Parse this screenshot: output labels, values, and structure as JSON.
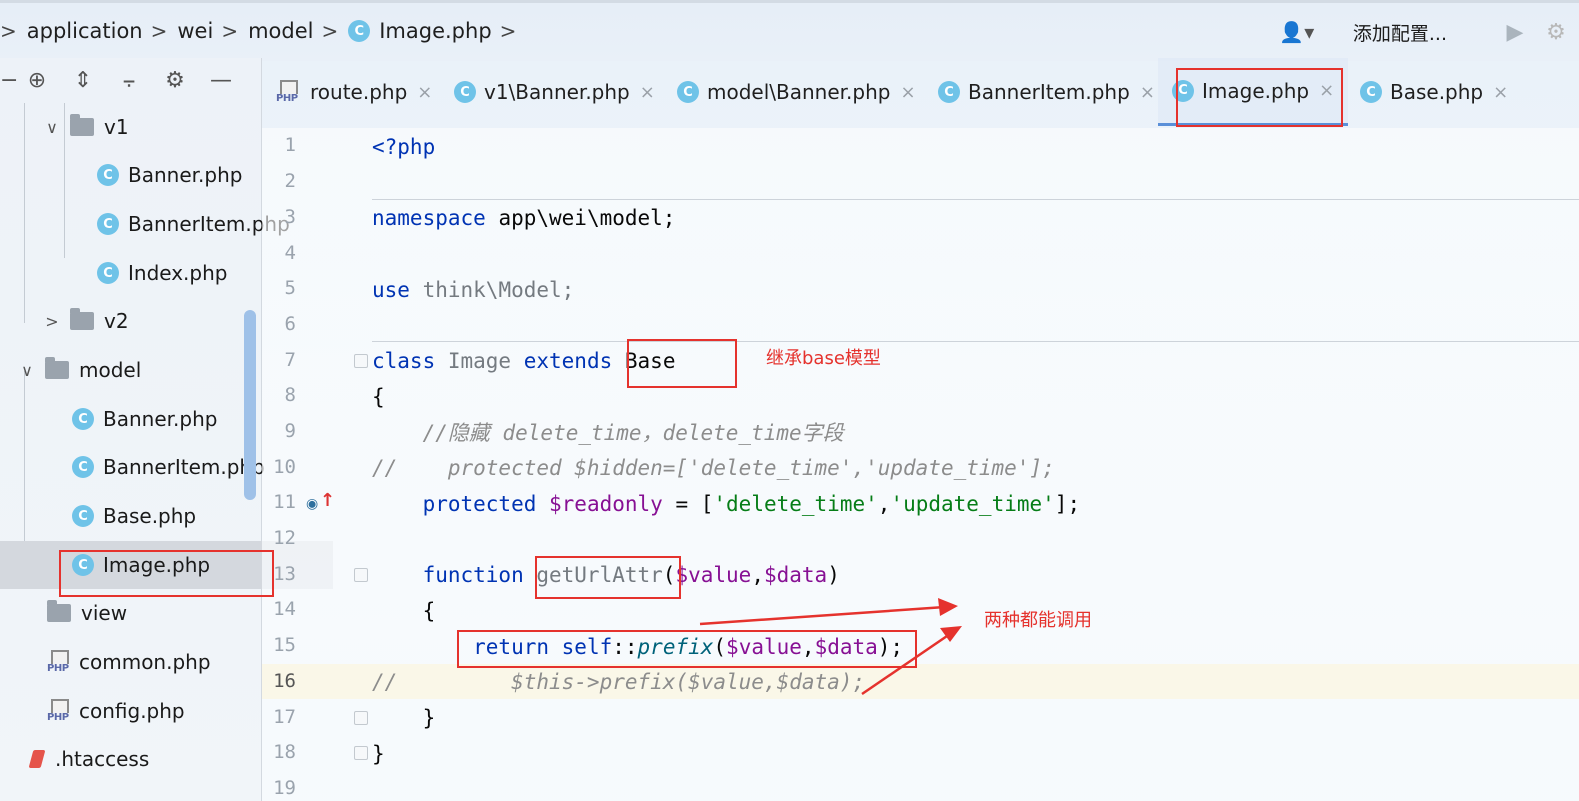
{
  "breadcrumbs": [
    {
      "label": "application"
    },
    {
      "label": "wei"
    },
    {
      "label": "model"
    },
    {
      "label": "Image.php",
      "icon": "class-icon"
    }
  ],
  "toolbar": {
    "config_label": "添加配置...",
    "icons": [
      "user-icon",
      "run-icon",
      "debug-icon"
    ]
  },
  "sidebar": {
    "toolbar_icons": [
      "locate-icon",
      "expand-all-icon",
      "collapse-all-icon",
      "gear-icon",
      "minimize-icon"
    ],
    "tree": [
      {
        "label": "v1",
        "type": "folder",
        "expanded": true
      },
      {
        "label": "Banner.php",
        "type": "class"
      },
      {
        "label": "BannerItem.php",
        "type": "class"
      },
      {
        "label": "Index.php",
        "type": "class"
      },
      {
        "label": "v2",
        "type": "folder",
        "expanded": false
      },
      {
        "label": "model",
        "type": "folder",
        "expanded": true
      },
      {
        "label": "Banner.php",
        "type": "class"
      },
      {
        "label": "BannerItem.php",
        "type": "class"
      },
      {
        "label": "Base.php",
        "type": "class"
      },
      {
        "label": "Image.php",
        "type": "class",
        "selected": true
      },
      {
        "label": "view",
        "type": "folder"
      },
      {
        "label": "common.php",
        "type": "php"
      },
      {
        "label": "config.php",
        "type": "php"
      },
      {
        "label": ".htaccess",
        "type": "htaccess"
      }
    ]
  },
  "tabs": [
    {
      "label": "route.php",
      "type": "php"
    },
    {
      "label": "v1\\Banner.php",
      "type": "class"
    },
    {
      "label": "model\\Banner.php",
      "type": "class"
    },
    {
      "label": "BannerItem.php",
      "type": "class"
    },
    {
      "label": "Image.php",
      "type": "class",
      "active": true
    },
    {
      "label": "Base.php",
      "type": "class"
    }
  ],
  "icon_text": {
    "class": "C",
    "php": "PHP",
    "close": "×"
  },
  "editor": {
    "line_numbers": [
      "1",
      "2",
      "3",
      "4",
      "5",
      "6",
      "7",
      "8",
      "9",
      "10",
      "11",
      "12",
      "13",
      "14",
      "15",
      "16",
      "17",
      "18",
      "19"
    ],
    "current_line": "16",
    "code": {
      "l1": "<?php",
      "l3_kw": "namespace",
      "l3_rest": " app\\wei\\model;",
      "l5_kw": "use",
      "l5_rest": " think\\Model;",
      "l7_kw1": "class",
      "l7_name": " Image ",
      "l7_kw2": "extends",
      "l7_base": " Base",
      "l8": "{",
      "l9": "    //隐藏 delete_time，delete_time字段",
      "l10": "//    protected $hidden=['delete_time','update_time'];",
      "l11_kw": "    protected",
      "l11_var": " $readonly",
      "l11_mid": " = [",
      "l11_s1": "'delete_time'",
      "l11_comma": ",",
      "l11_s2": "'update_time'",
      "l11_end": "];",
      "l13_kw": "    function",
      "l13_name": " getUrlAttr",
      "l13_p1": "(",
      "l13_v1": "$value",
      "l13_c": ",",
      "l13_v2": "$data",
      "l13_p2": ")",
      "l14": "    {",
      "l15_kw": "        return",
      "l15_self": " self",
      "l15_op": "::",
      "l15_fn": "prefix",
      "l15_p1": "(",
      "l15_v1": "$value",
      "l15_c": ",",
      "l15_v2": "$data",
      "l15_end": ");",
      "l16": "//         $this->prefix($value,$data);",
      "l17": "    }",
      "l18": "}"
    }
  },
  "annotations": {
    "inherit_note": "继承base模型",
    "both_note": "两种都能调用",
    "color": "#e5322d"
  }
}
